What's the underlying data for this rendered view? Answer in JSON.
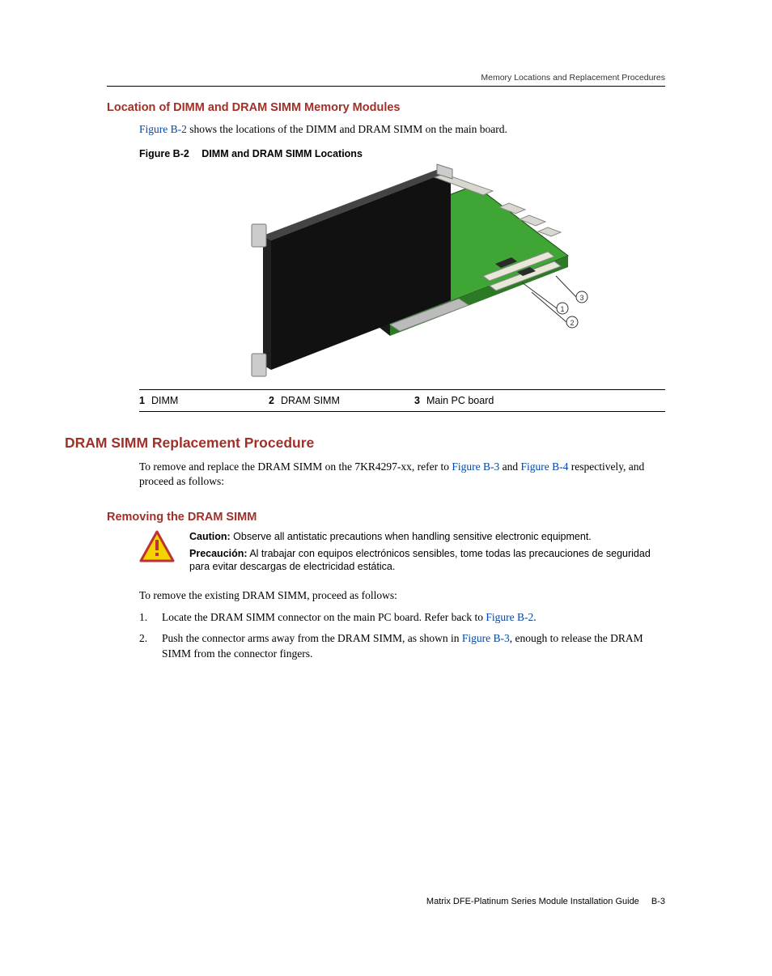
{
  "running_header": "Memory Locations and Replacement Procedures",
  "section_loc_title": "Location of DIMM and DRAM SIMM Memory Modules",
  "loc_intro_pre": " shows the locations of the DIMM and DRAM SIMM on the main board.",
  "loc_intro_link": "Figure B-2",
  "figure": {
    "label": "Figure B-2",
    "title": "DIMM and DRAM SIMM Locations",
    "legend": [
      {
        "n": "1",
        "label": "DIMM"
      },
      {
        "n": "2",
        "label": "DRAM SIMM"
      },
      {
        "n": "3",
        "label": "Main PC board"
      }
    ]
  },
  "section_dram_title": "DRAM SIMM Replacement Procedure",
  "dram_intro_pre": "To remove and replace the DRAM SIMM on the 7KR4297-xx, refer to ",
  "dram_intro_link1": "Figure B-3",
  "dram_intro_mid": " and ",
  "dram_intro_link2": "Figure B-4",
  "dram_intro_post": " respectively, and proceed as follows:",
  "removing_title": "Removing the DRAM SIMM",
  "caution": {
    "label_en": "Caution:",
    "text_en": " Observe all antistatic precautions when handling sensitive electronic equipment.",
    "label_es": "Precaución:",
    "text_es": " Al trabajar con equipos electrónicos sensibles, tome todas las precauciones de seguridad para evitar descargas  de electricidad estática."
  },
  "remove_intro": "To remove the existing DRAM SIMM, proceed as follows:",
  "steps": [
    {
      "n": "1.",
      "pre": "Locate the DRAM SIMM connector on the main PC board. Refer back to ",
      "link": "Figure B-2",
      "post": "."
    },
    {
      "n": "2.",
      "pre": "Push the connector arms away from the DRAM SIMM, as shown in ",
      "link": "Figure B-3",
      "post": ", enough to release the DRAM SIMM from the connector fingers."
    }
  ],
  "footer": {
    "doc": "Matrix DFE-Platinum Series Module Installation Guide",
    "page": "B-3"
  }
}
